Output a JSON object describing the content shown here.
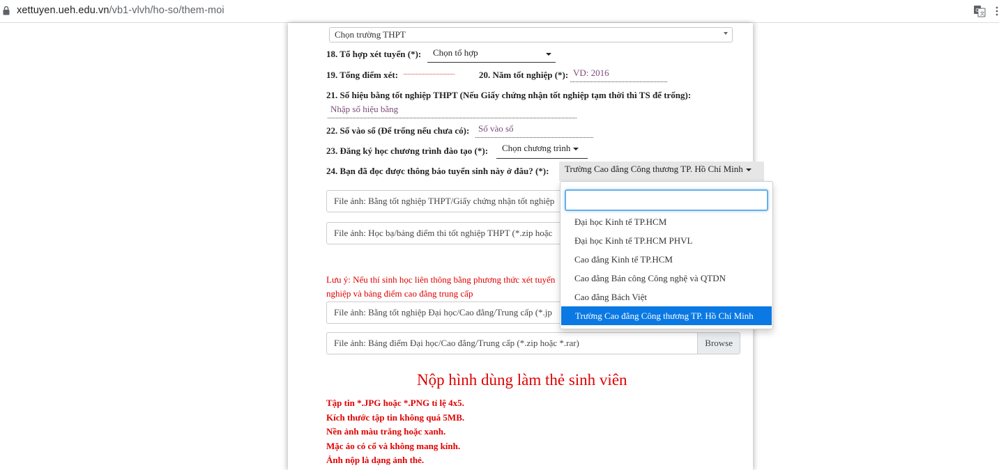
{
  "browser": {
    "url_host": "xettuyen.ueh.edu.vn",
    "url_path": "/vb1-vlvh/ho-so/them-moi"
  },
  "form": {
    "school_select": "Chọn trường THPT",
    "q18_label": "18. Tổ hợp xét tuyển (*):",
    "q18_value": "Chọn tổ hợp",
    "q19_label": "19. Tổng điểm xét:",
    "q20_label": "20. Năm tốt nghiệp (*):",
    "q20_placeholder": "VD: 2016",
    "q21_label": "21. Số hiệu bằng tốt nghiệp THPT (Nếu Giấy chứng nhận tốt nghiệp tạm thời thì TS để trống):",
    "q21_placeholder": "Nhập số hiệu bằng",
    "q22_label": "22. Số vào sổ (Để trống nếu chưa có):",
    "q22_placeholder": "Số vào sổ",
    "q23_label": "23. Đăng ký học chương trình đào tạo (*):",
    "q23_value": "Chọn chương trình",
    "q24_label": "24. Bạn đã đọc được thông báo tuyển sinh này ở đâu? (*):",
    "q24_value": "Trường Cao đẳng Công thương TP. Hồ Chí Minh"
  },
  "files": {
    "file1": "File ảnh: Bằng tốt nghiệp THPT/Giấy chứng nhận tốt nghiệp",
    "file2": "File ảnh: Học bạ/bảng điểm thi tốt nghiệp THPT (*.zip hoặc",
    "file3": "File ảnh: Bằng tốt nghiệp Đại học/Cao đẳng/Trung cấp (*.jp",
    "file4": "File ảnh: Bảng điểm Đại học/Cao đẳng/Trung cấp (*.zip hoặc *.rar)",
    "browse_label": "Browse"
  },
  "note": {
    "line1": "Lưu ý: Nếu thí sinh học liên thông bằng phương thức xét tuyển",
    "line2": "nghiệp và bảng điểm cao đẳng trung cấp"
  },
  "photo": {
    "title": "Nộp hình dùng làm thẻ sinh viên",
    "rules": [
      "Tập tin *.JPG hoặc *.PNG tỉ lệ 4x5.",
      "Kích thước tập tin không quá 5MB.",
      "Nền ảnh màu trắng hoặc xanh.",
      "Mặc áo có cổ và không mang kính.",
      "Ảnh nộp là dạng ảnh thẻ."
    ]
  },
  "dropdown": {
    "search_value": "",
    "items": [
      "Đại học Kinh tế TP.HCM",
      "Đại học Kinh tế TP.HCM PHVL",
      "Cao đẳng Kinh tế TP.HCM",
      "Cao đẳng Bán công Công nghệ và QTDN",
      "Cao đẳng Bách Việt",
      "Trường Cao đẳng Công thương TP. Hồ Chí Minh"
    ],
    "selected_index": 5,
    "selected_color": "#0b79e4"
  },
  "colors": {
    "accent_red": "#e00000",
    "focus_blue": "#66afe9"
  }
}
